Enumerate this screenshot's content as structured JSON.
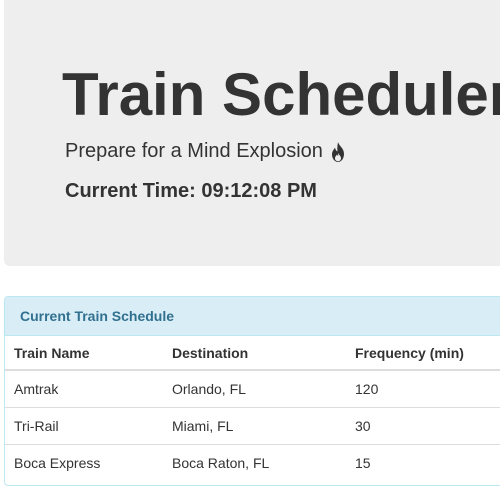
{
  "header": {
    "title": "Train Scheduler",
    "lead": "Prepare for a Mind Explosion",
    "lead_icon": "fire-icon",
    "current_time_label": "Current Time:",
    "current_time_value": "09:12:08 PM"
  },
  "schedule": {
    "heading": "Current Train Schedule",
    "columns": [
      "Train Name",
      "Destination",
      "Frequency (min)"
    ],
    "rows": [
      [
        "Amtrak",
        "Orlando, FL",
        "120"
      ],
      [
        "Tri-Rail",
        "Miami, FL",
        "30"
      ],
      [
        "Boca Express",
        "Boca Raton, FL",
        "15"
      ]
    ]
  },
  "colors": {
    "jumbotron_bg": "#eeeeee",
    "panel_heading_bg": "#d9edf7",
    "panel_heading_text": "#31708f",
    "panel_border": "#bce8f1"
  }
}
